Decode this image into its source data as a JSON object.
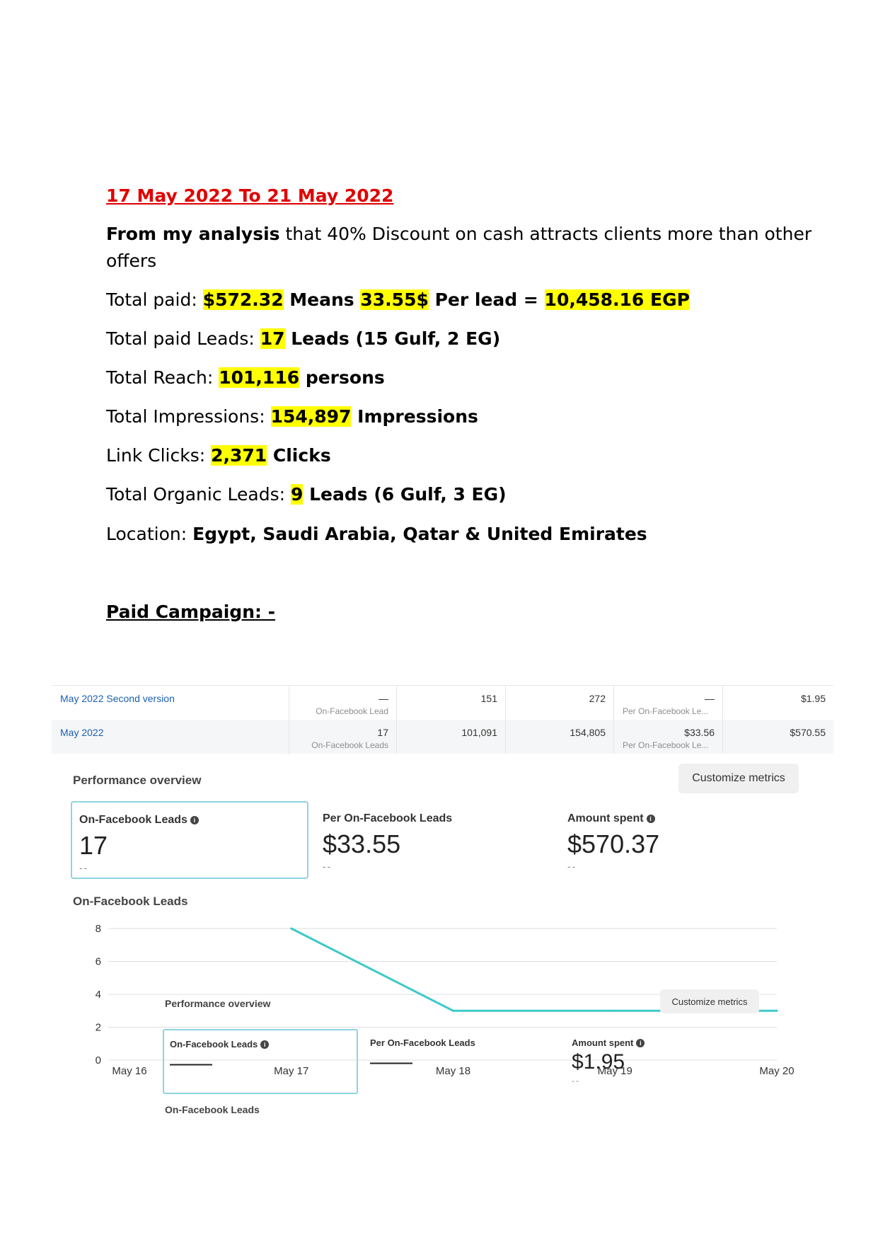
{
  "document": {
    "date_range": "17 May 2022 To 21 May 2022",
    "analysis": {
      "bold": "From my analysis",
      "rest_line1": " that 40% Discount on cash attracts clients more than other",
      "line2": "offers"
    },
    "total_paid": {
      "label": "Total paid: ",
      "amount": "$572.32",
      "means": " Means ",
      "per_lead": "33.55$",
      "per_lead_text": " Per lead = ",
      "egp": "10,458.16 EGP"
    },
    "paid_leads": {
      "label": "Total paid Leads: ",
      "value": "17",
      "suffix": " Leads (15 Gulf, 2 EG)"
    },
    "reach": {
      "label": "Total Reach: ",
      "value": "101,116",
      "suffix": " persons"
    },
    "impressions": {
      "label": "Total Impressions: ",
      "value": "154,897",
      "suffix": " Impressions"
    },
    "link_clicks": {
      "label": "Link Clicks: ",
      "value": "2,371",
      "suffix": " Clicks"
    },
    "organic_leads": {
      "label": " Total Organic Leads: ",
      "value": "9",
      "suffix": " Leads (6 Gulf, 3 EG)"
    },
    "location": {
      "label": "Location: ",
      "value": "Egypt, Saudi Arabia, Qatar & United Emirates"
    },
    "paid_campaign_title": "Paid Campaign: -"
  },
  "table": {
    "rows": [
      {
        "name": "May 2022 Second version",
        "leads": "—",
        "leads_sub": "On-Facebook Lead",
        "reach": "151",
        "impressions": "272",
        "cost": "—",
        "cost_sub": "Per On-Facebook Le...",
        "spent": "$1.95"
      },
      {
        "name": "May 2022",
        "leads": "17",
        "leads_sub": "On-Facebook Leads",
        "reach": "101,091",
        "impressions": "154,805",
        "cost": "$33.56",
        "cost_sub": "Per On-Facebook Le...",
        "spent": "$570.55"
      }
    ]
  },
  "overview": {
    "title": "Performance overview",
    "customize": "Customize metrics",
    "metrics": [
      {
        "label": "On-Facebook Leads",
        "value": "17",
        "delta": "--"
      },
      {
        "label": "Per On-Facebook Leads",
        "value": "$33.55",
        "delta": "--"
      },
      {
        "label": "Amount spent",
        "value": "$570.37",
        "delta": "--"
      }
    ],
    "chart_title": "On-Facebook Leads"
  },
  "chart_data": {
    "type": "line",
    "title": "On-Facebook Leads",
    "x": [
      "May 17",
      "May 18",
      "May 19",
      "May 20"
    ],
    "categories": [
      "May 16",
      "May 17",
      "May 18",
      "May 19",
      "May 20"
    ],
    "series": [
      {
        "values": [
          8,
          3,
          3,
          3
        ]
      }
    ],
    "yticks": [
      0,
      2,
      4,
      6,
      8
    ],
    "ylim": [
      0,
      8
    ],
    "grid": true,
    "color": "#3ec9c9"
  },
  "overview2": {
    "title": "Performance overview",
    "customize": "Customize metrics",
    "metrics": [
      {
        "label": "On-Facebook Leads",
        "value": "——",
        "delta": ""
      },
      {
        "label": "Per On-Facebook Leads",
        "value": "——",
        "delta": ""
      },
      {
        "label": "Amount spent",
        "value": "$1.95",
        "delta": "--"
      }
    ],
    "chart_title": "On-Facebook Leads"
  }
}
